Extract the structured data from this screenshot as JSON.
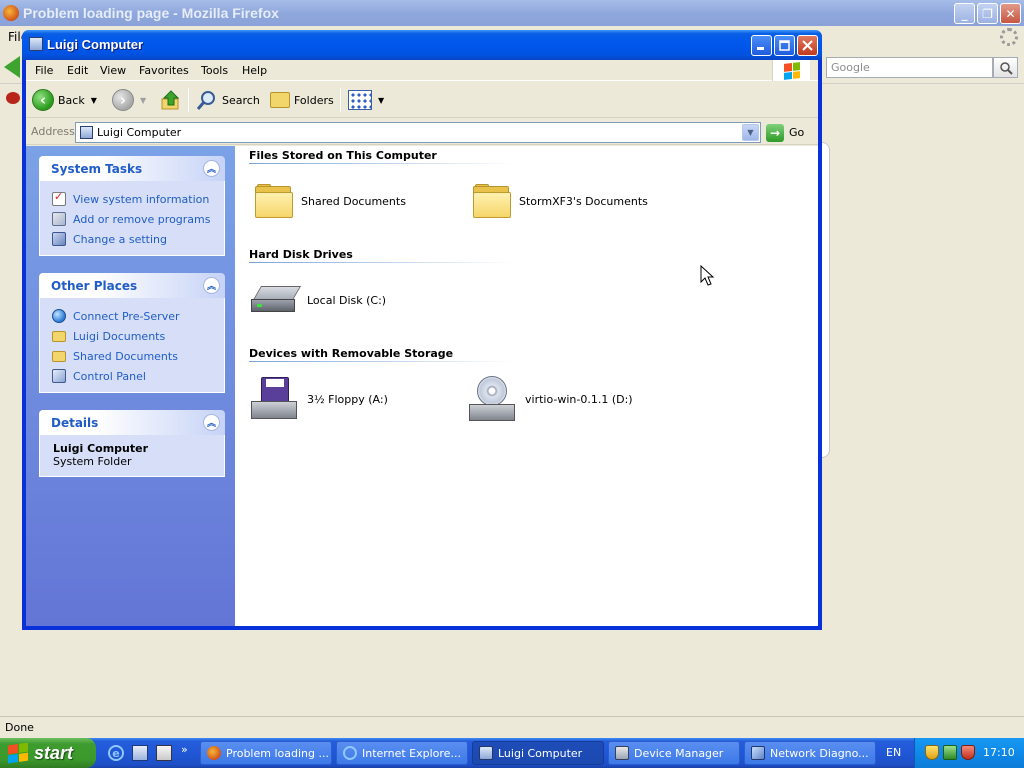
{
  "firefox": {
    "title": "Problem loading page - Mozilla Firefox",
    "menu_file": "File",
    "search_placeholder": "Google",
    "status": "Done",
    "caption": {
      "minimize": "_",
      "restore": "❐",
      "close": "✕"
    }
  },
  "explorer": {
    "title": "Luigi Computer",
    "menu": [
      "File",
      "Edit",
      "View",
      "Favorites",
      "Tools",
      "Help"
    ],
    "toolbar": {
      "back": "Back",
      "search": "Search",
      "folders": "Folders"
    },
    "address": {
      "label": "Address",
      "value": "Luigi Computer",
      "go": "Go"
    },
    "taskpane": {
      "system_tasks": {
        "title": "System Tasks",
        "links": [
          "View system information",
          "Add or remove programs",
          "Change a setting"
        ]
      },
      "other_places": {
        "title": "Other Places",
        "links": [
          "Connect Pre-Server",
          "Luigi Documents",
          "Shared Documents",
          "Control Panel"
        ]
      },
      "details": {
        "title": "Details",
        "name": "Luigi Computer",
        "type": "System Folder"
      }
    },
    "groups": {
      "files_stored": {
        "title": "Files Stored on This Computer",
        "items": [
          "Shared Documents",
          "StormXF3's Documents"
        ]
      },
      "hard_disks": {
        "title": "Hard Disk Drives",
        "items": [
          "Local Disk (C:)"
        ]
      },
      "removable": {
        "title": "Devices with Removable Storage",
        "items": [
          "3½ Floppy (A:)",
          "virtio-win-0.1.1 (D:)"
        ]
      }
    }
  },
  "taskbar": {
    "start": "start",
    "quick_launch_more": "»",
    "tasks": [
      "Problem loading ...",
      "Internet Explore...",
      "Luigi Computer",
      "Device Manager",
      "Network Diagno..."
    ],
    "active_task": "Luigi Computer",
    "language": "EN",
    "clock": "17:10"
  },
  "colors": {
    "xp_blue": "#0058EE",
    "taskpane_link": "#215DC6",
    "start_green": "#3C9A2C"
  }
}
